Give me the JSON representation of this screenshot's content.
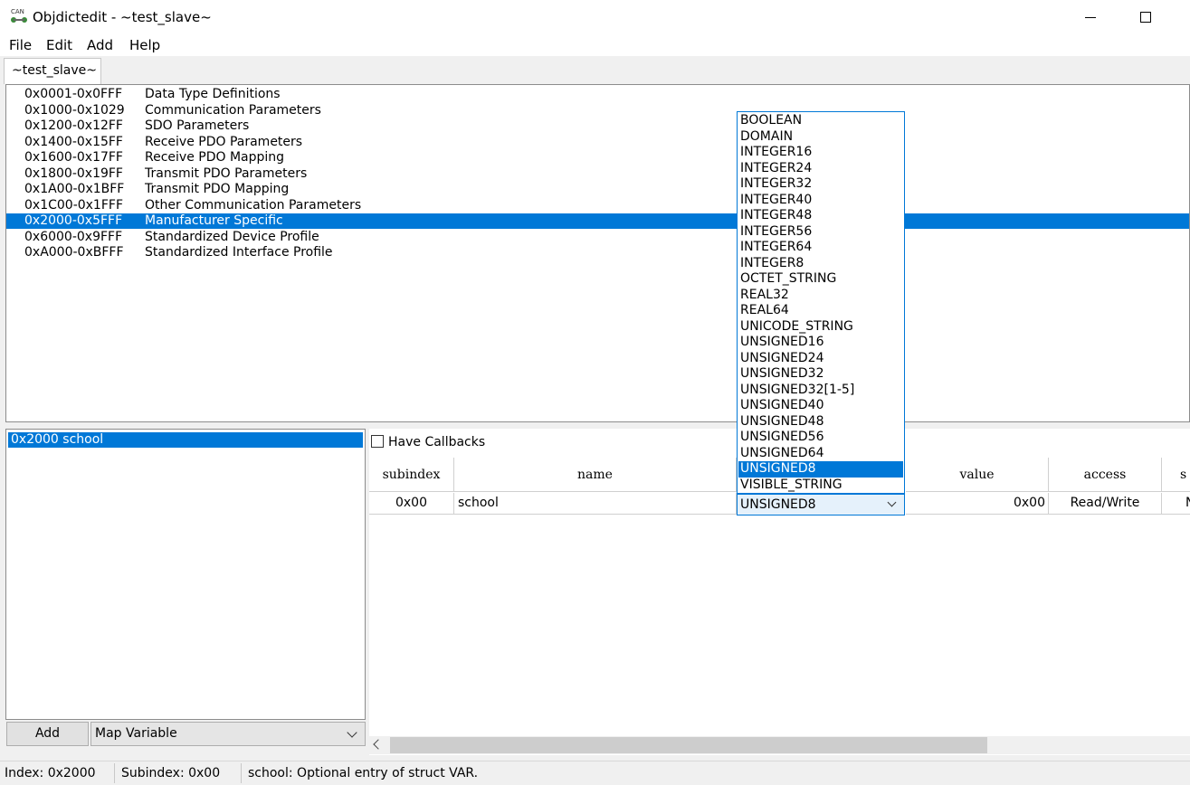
{
  "window": {
    "title": "Objdictedit - ~test_slave~",
    "icon_text": "CAN"
  },
  "menu": [
    "File",
    "Edit",
    "Add",
    "Help"
  ],
  "tab": {
    "label": "~test_slave~"
  },
  "ranges": [
    {
      "range": "0x0001-0x0FFF",
      "desc": "Data Type Definitions"
    },
    {
      "range": "0x1000-0x1029",
      "desc": "Communication Parameters"
    },
    {
      "range": "0x1200-0x12FF",
      "desc": "SDO Parameters"
    },
    {
      "range": "0x1400-0x15FF",
      "desc": "Receive PDO Parameters"
    },
    {
      "range": "0x1600-0x17FF",
      "desc": "Receive PDO Mapping"
    },
    {
      "range": "0x1800-0x19FF",
      "desc": "Transmit PDO Parameters"
    },
    {
      "range": "0x1A00-0x1BFF",
      "desc": "Transmit PDO Mapping"
    },
    {
      "range": "0x1C00-0x1FFF",
      "desc": "Other Communication Parameters"
    },
    {
      "range": "0x2000-0x5FFF",
      "desc": "Manufacturer Specific"
    },
    {
      "range": "0x6000-0x9FFF",
      "desc": "Standardized Device Profile"
    },
    {
      "range": "0xA000-0xBFFF",
      "desc": "Standardized Interface Profile"
    }
  ],
  "selected_range_index": 8,
  "entries": [
    {
      "label": "0x2000   school"
    }
  ],
  "add_button": "Add",
  "map_combo": "Map Variable",
  "have_callbacks": {
    "label": "Have Callbacks",
    "checked": false
  },
  "grid": {
    "headers": [
      "subindex",
      "name",
      "value",
      "access",
      "s"
    ],
    "row": {
      "subindex": "0x00",
      "name": "school",
      "type": "UNSIGNED8",
      "value": "0x00",
      "access": "Read/Write",
      "save": "N"
    }
  },
  "type_options": [
    "BOOLEAN",
    "DOMAIN",
    "INTEGER16",
    "INTEGER24",
    "INTEGER32",
    "INTEGER40",
    "INTEGER48",
    "INTEGER56",
    "INTEGER64",
    "INTEGER8",
    "OCTET_STRING",
    "REAL32",
    "REAL64",
    "UNICODE_STRING",
    "UNSIGNED16",
    "UNSIGNED24",
    "UNSIGNED32",
    "UNSIGNED32[1-5]",
    "UNSIGNED40",
    "UNSIGNED48",
    "UNSIGNED56",
    "UNSIGNED64",
    "UNSIGNED8",
    "VISIBLE_STRING"
  ],
  "selected_type_index": 22,
  "status": {
    "index": "Index: 0x2000",
    "subindex": "Subindex: 0x00",
    "message": "school: Optional entry of struct VAR."
  },
  "colors": {
    "selection": "#0078d7"
  }
}
